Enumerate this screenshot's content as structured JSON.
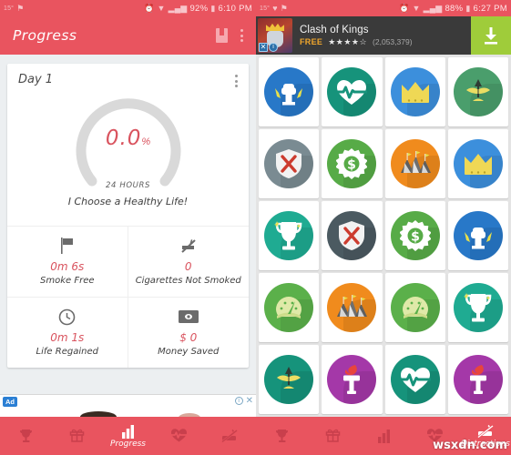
{
  "left": {
    "status": {
      "temp": "15°",
      "icons": [
        "flag-icon"
      ],
      "alarm": "alarm-icon",
      "wifi": "wifi-icon",
      "signal": "signal-icon",
      "battery_pct": "92%",
      "battery": "battery-icon",
      "clock": "6:10 PM"
    },
    "appbar": {
      "title": "Progress",
      "book_icon": "book-icon",
      "menu_icon": "overflow-menu-icon"
    },
    "card": {
      "day": "Day 1",
      "percent": "0.0",
      "percent_symbol": "%",
      "hours": "24 HOURS",
      "motto": "I Choose a Healthy Life!",
      "ring_track_color": "#d9d9d9",
      "accent_color": "#d9535e"
    },
    "stats": [
      {
        "icon": "flag-icon",
        "value": "0m 6s",
        "label": "Smoke Free"
      },
      {
        "icon": "no-smoking-icon",
        "value": "0",
        "label": "Cigarettes Not Smoked"
      },
      {
        "icon": "clock-icon",
        "value": "0m 1s",
        "label": "Life Regained"
      },
      {
        "icon": "money-icon",
        "value": "$ 0",
        "label": "Money Saved"
      }
    ],
    "ad": {
      "badge": "Ad",
      "info_icon": "info-icon",
      "close_icon": "close-icon"
    },
    "nav": [
      {
        "icon": "trophy-icon",
        "label": "",
        "active": false
      },
      {
        "icon": "gift-icon",
        "label": "",
        "active": false
      },
      {
        "icon": "bar-chart-icon",
        "label": "Progress",
        "active": true
      },
      {
        "icon": "heartbeat-icon",
        "label": "",
        "active": false
      },
      {
        "icon": "no-smoking-icon",
        "label": "",
        "active": false
      }
    ]
  },
  "right": {
    "status": {
      "temp": "15°",
      "battery_pct": "88%",
      "clock": "6:27 PM"
    },
    "ad": {
      "title": "Clash of Kings",
      "price": "FREE",
      "stars": "★★★★☆",
      "rating_count": "(2,053,379)",
      "download_icon": "download-icon",
      "close_icon": "close-icon",
      "info_icon": "info-icon"
    },
    "badges": [
      {
        "icon": "fist-icon",
        "circle": "#2878c8",
        "glyph": "#ffffff"
      },
      {
        "icon": "heartbeat-icon",
        "circle": "#16937b",
        "glyph": "#ffffff"
      },
      {
        "icon": "crown-icon",
        "circle": "#3c8fdc",
        "glyph": "#efd855"
      },
      {
        "icon": "plant-icon",
        "circle": "#4a9e6c",
        "glyph": "#eadd63"
      },
      {
        "icon": "shield-x-icon",
        "circle": "#7a8b92",
        "glyph": "#f2f2f2"
      },
      {
        "icon": "gear-money-icon",
        "circle": "#57ab47",
        "glyph": "#ffffff"
      },
      {
        "icon": "mountains-icon",
        "circle": "#f08b1d",
        "glyph": "#5c5c5c"
      },
      {
        "icon": "crown-icon",
        "circle": "#3c8fdc",
        "glyph": "#efd855"
      },
      {
        "icon": "trophy-icon",
        "circle": "#1fab92",
        "glyph": "#ffffff"
      },
      {
        "icon": "shield-x-icon",
        "circle": "#4b5a61",
        "glyph": "#f2f2f2"
      },
      {
        "icon": "gear-money-icon",
        "circle": "#57ab47",
        "glyph": "#ffffff"
      },
      {
        "icon": "fist-icon",
        "circle": "#2878c8",
        "glyph": "#ffffff"
      },
      {
        "icon": "gauge-icon",
        "circle": "#5bb04a",
        "glyph": "#dfe9a8"
      },
      {
        "icon": "mountains-icon",
        "circle": "#f08b1d",
        "glyph": "#5c5c5c"
      },
      {
        "icon": "gauge-icon",
        "circle": "#5bb04a",
        "glyph": "#dfe9a8"
      },
      {
        "icon": "trophy-icon",
        "circle": "#1fab92",
        "glyph": "#ffffff"
      },
      {
        "icon": "plant-icon",
        "circle": "#16937b",
        "glyph": "#eadd63"
      },
      {
        "icon": "torch-icon",
        "circle": "#a438a8",
        "glyph": "#ffffff"
      },
      {
        "icon": "heartbeat-icon",
        "circle": "#16937b",
        "glyph": "#ffffff"
      },
      {
        "icon": "torch-icon",
        "circle": "#a438a8",
        "glyph": "#ffffff"
      }
    ],
    "nav": [
      {
        "icon": "trophy-icon",
        "label": "",
        "active": false
      },
      {
        "icon": "gift-icon",
        "label": "",
        "active": false
      },
      {
        "icon": "bar-chart-icon",
        "label": "",
        "active": false
      },
      {
        "icon": "heartbeat-icon",
        "label": "",
        "active": false
      },
      {
        "icon": "no-smoking-icon",
        "label": "Distractions",
        "active": true
      }
    ],
    "watermark": "wsxdn.com"
  },
  "theme": {
    "primary": "#e9545f",
    "accent": "#d9535e",
    "ad_green": "#9fcc3a",
    "ad_orange": "#f0a62c"
  }
}
